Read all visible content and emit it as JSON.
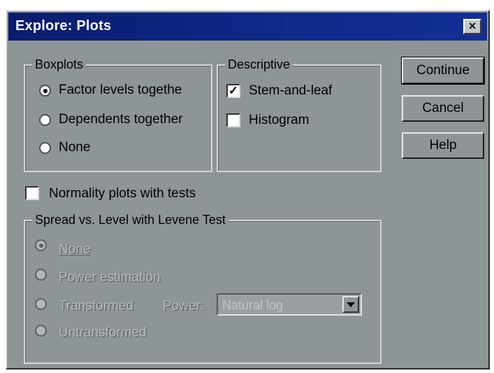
{
  "window": {
    "title": "Explore: Plots",
    "close_glyph": "×"
  },
  "boxplots": {
    "legend": "Boxplots",
    "options": [
      {
        "label": "Factor levels togethe",
        "checked": true
      },
      {
        "label": "Dependents together",
        "checked": false
      },
      {
        "label": "None",
        "checked": false
      }
    ]
  },
  "descriptive": {
    "legend": "Descriptive",
    "options": [
      {
        "label": "Stem-and-leaf",
        "checked": true
      },
      {
        "label": "Histogram",
        "checked": false
      }
    ]
  },
  "normality": {
    "label": "Normality plots with tests",
    "checked": false
  },
  "spread": {
    "legend": "Spread vs. Level with Levene Test",
    "options": [
      {
        "label": "None",
        "checked": true,
        "enabled": false
      },
      {
        "label": "Power estimation",
        "checked": false,
        "enabled": false
      },
      {
        "label": "Transformed",
        "checked": false,
        "enabled": false
      },
      {
        "label": "Untransformed",
        "checked": false,
        "enabled": false
      }
    ],
    "power_label": "Power:",
    "power_value": "Natural log"
  },
  "buttons": {
    "continue": "Continue",
    "cancel": "Cancel",
    "help": "Help"
  },
  "icons": {
    "checkmark": "check-icon",
    "dropdown": "chevron-down-icon",
    "close": "close-icon"
  },
  "colors": {
    "titlebar": "#0f2a8a",
    "dialog_bg": "#8e9597"
  }
}
